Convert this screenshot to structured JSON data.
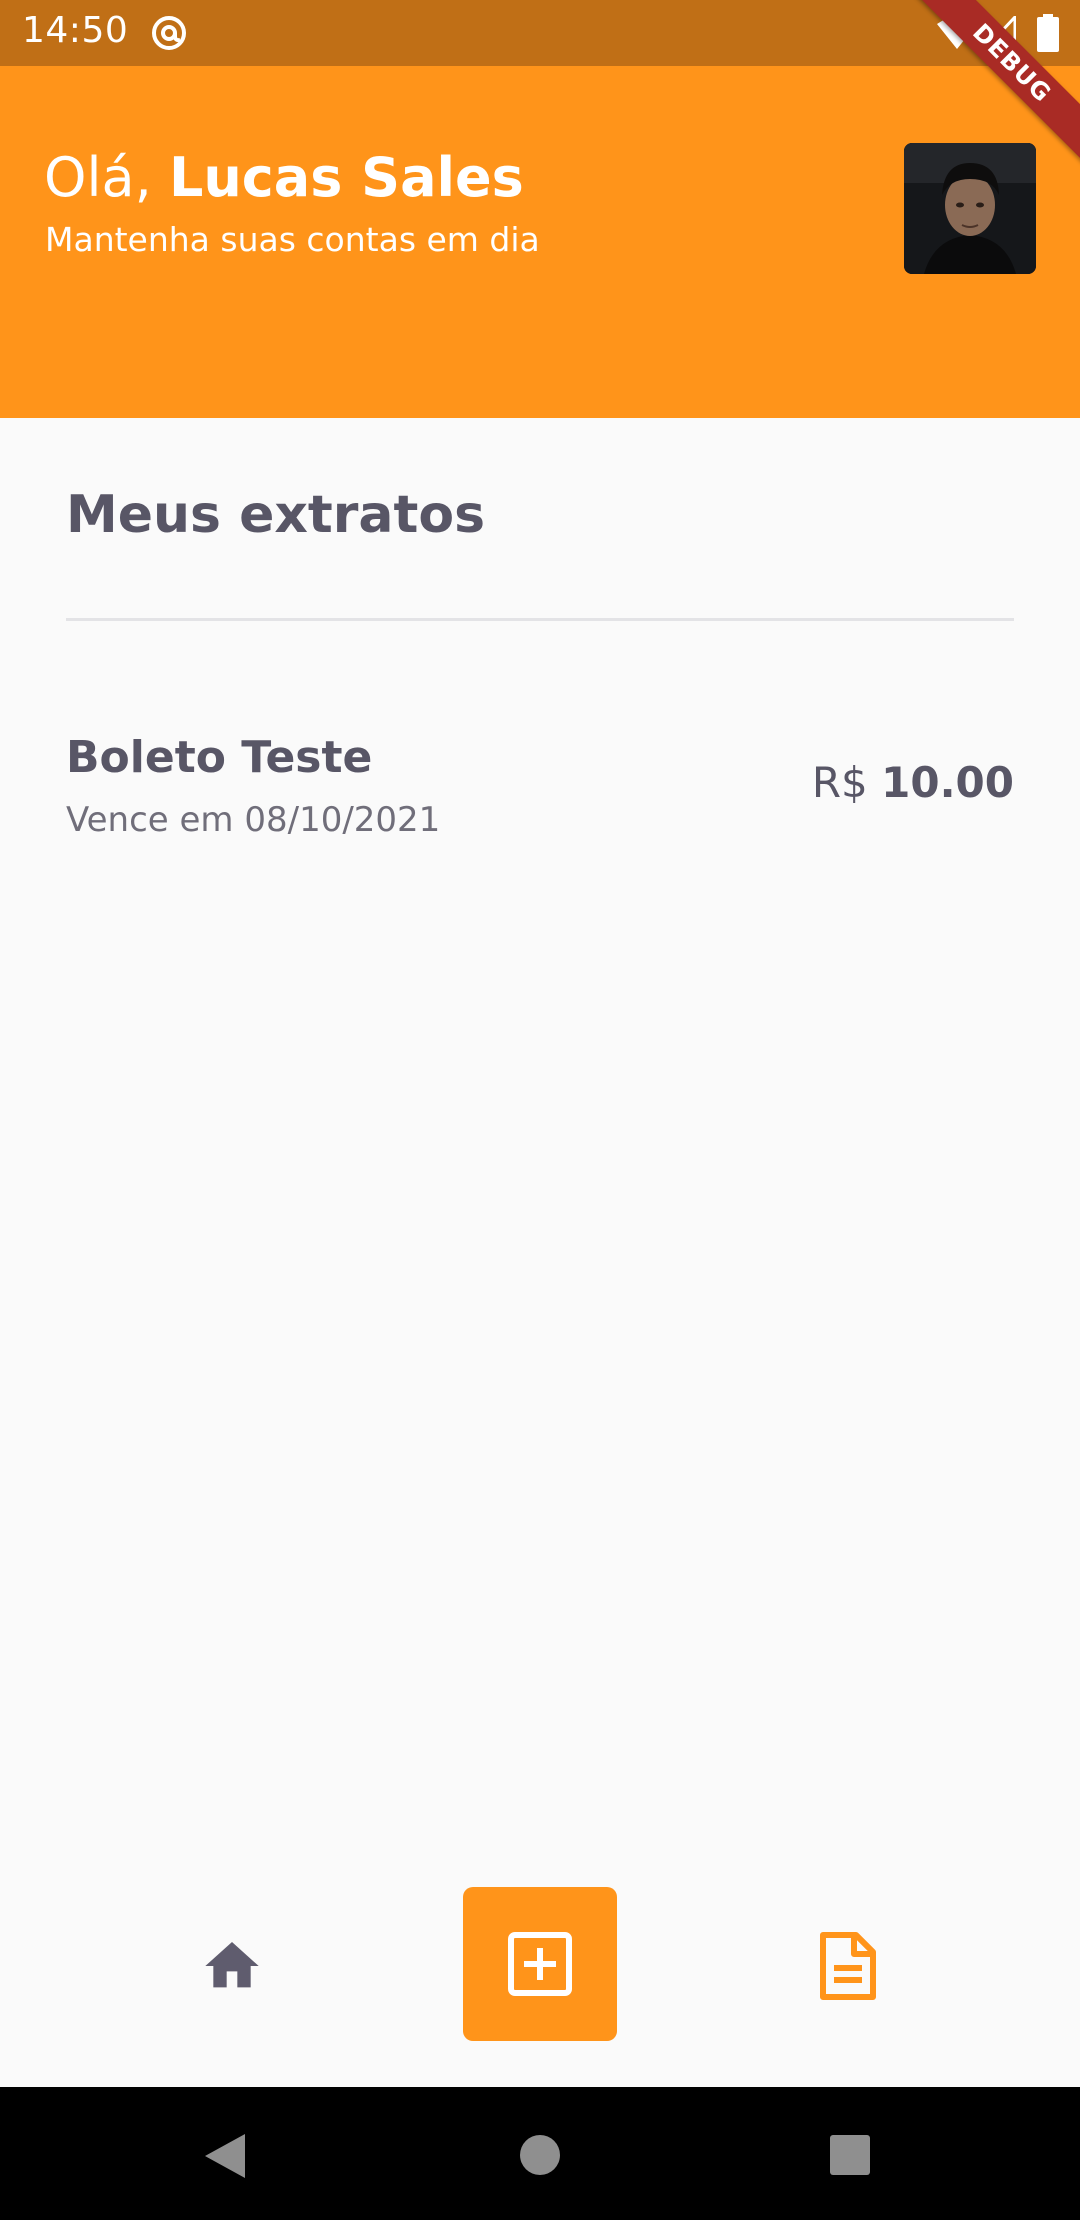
{
  "status_bar": {
    "time": "14:50",
    "icons": [
      "at-sign-icon",
      "wifi-icon",
      "signal-icon",
      "battery-icon"
    ],
    "background": "#C06F16"
  },
  "debug_banner": {
    "label": "DEBUG",
    "color": "#A92B25"
  },
  "header": {
    "greeting_prefix": "Olá, ",
    "user_name": "Lucas Sales",
    "subtitle": "Mantenha suas contas em dia",
    "background": "#FF941A",
    "avatar_icon": "user-photo"
  },
  "main": {
    "section_title": "Meus extratos",
    "items": [
      {
        "title": "Boleto Teste",
        "due": "Vence em 08/10/2021",
        "currency": "R$ ",
        "amount": "10.00"
      }
    ]
  },
  "bottom_nav": {
    "items": [
      {
        "icon": "home-icon",
        "active": false
      },
      {
        "icon": "add-box-icon",
        "active": true
      },
      {
        "icon": "document-icon",
        "active": false
      }
    ],
    "accent": "#FF941A",
    "inactive_color": "#5F5C6E"
  },
  "system_nav": {
    "icons": [
      "back-icon",
      "home-circle-icon",
      "recents-icon"
    ]
  }
}
